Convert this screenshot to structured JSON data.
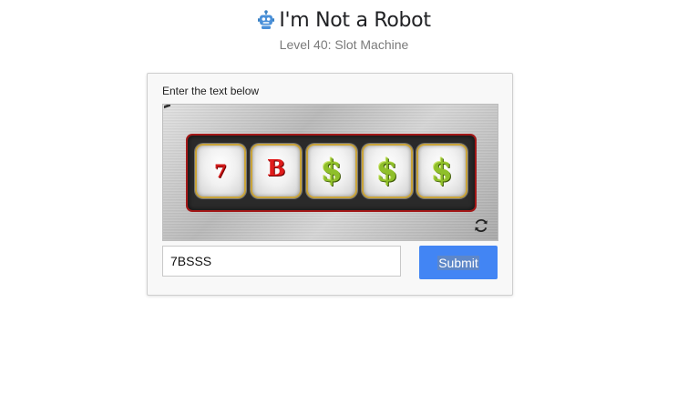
{
  "header": {
    "icon": "robot-icon",
    "title": "I'm Not a Robot",
    "subtitle": "Level 40: Slot Machine"
  },
  "card": {
    "prompt": "Enter the text below",
    "slot_machine": {
      "reels": [
        {
          "symbol": "7",
          "color": "#d11a1a"
        },
        {
          "symbol": "B",
          "color": "#e01c1c"
        },
        {
          "symbol": "$",
          "color": "#8fbf2a"
        },
        {
          "symbol": "$",
          "color": "#8fbf2a"
        },
        {
          "symbol": "$",
          "color": "#8fbf2a"
        }
      ],
      "refresh_icon": "refresh-icon"
    },
    "answer": {
      "value": "7BSSS"
    },
    "submit_label": "Submit"
  },
  "colors": {
    "accent": "#4285f4",
    "frame_border": "#a31818"
  }
}
